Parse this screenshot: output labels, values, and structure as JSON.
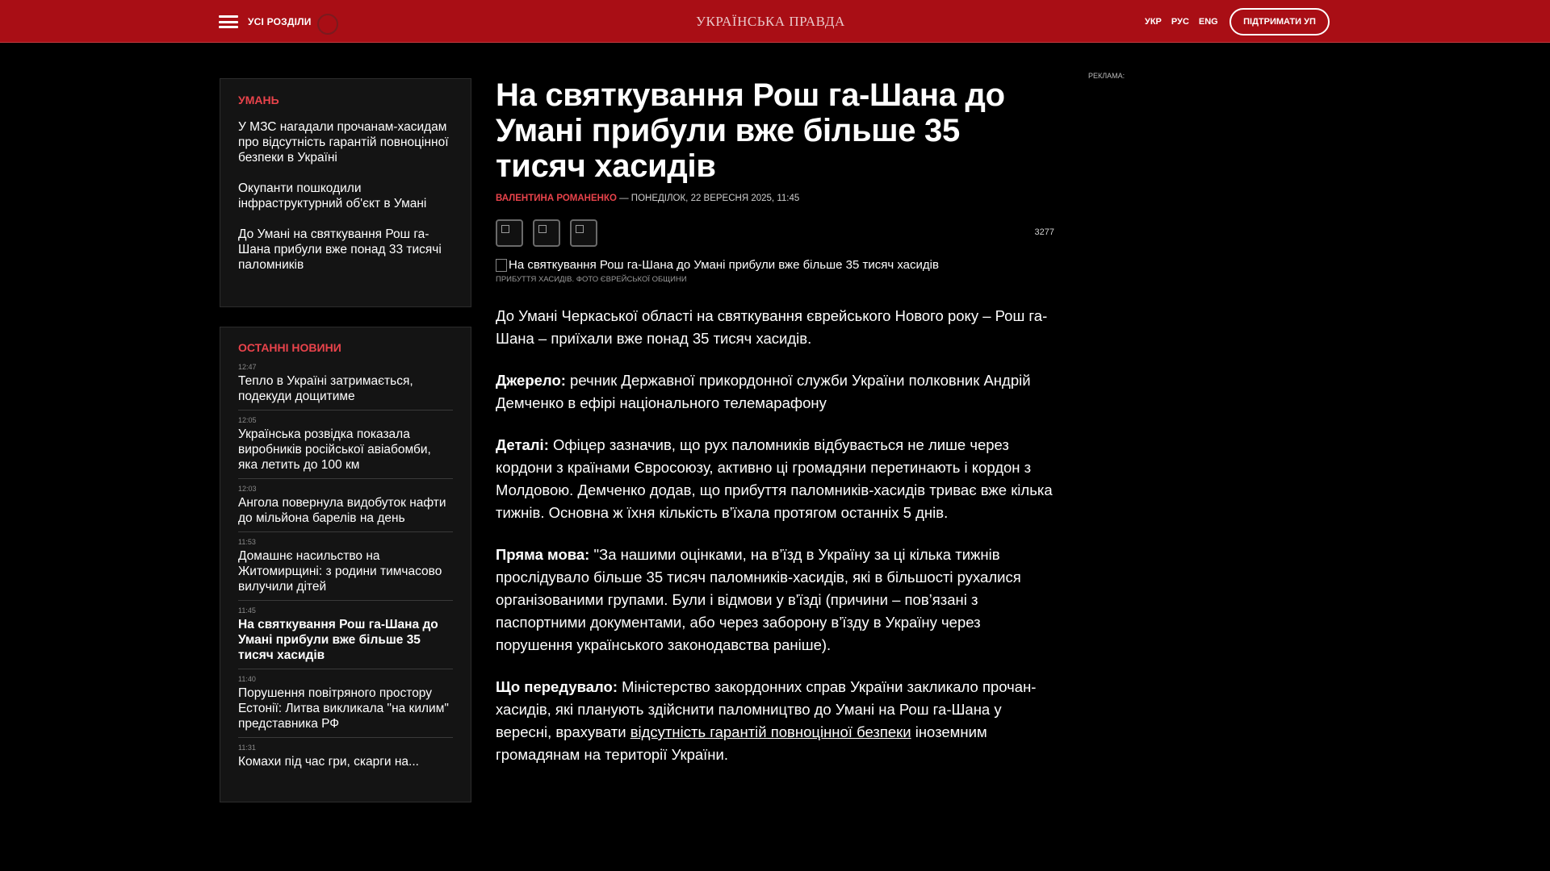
{
  "header": {
    "all_sections": "УСІ РОЗДІЛИ",
    "logo": "УКРАЇНСЬКА ПРАВДА",
    "langs": [
      "УКР",
      "РУС",
      "ENG"
    ],
    "support": "ПІДТРИМАТИ УП"
  },
  "topic_card": {
    "tag": "УМАНЬ",
    "items": [
      "У МЗС нагадали прочанам-хасидам про відсутність гарантій повноцінної безпеки в Україні",
      "Окупанти пошкодили інфраструктурний об'єкт в Умані",
      "До Умані на святкування Рош га-Шана прибули вже понад 33 тисячі паломників"
    ]
  },
  "latest": {
    "tag": "ОСТАННІ НОВИНИ",
    "items": [
      {
        "time": "12:47",
        "title": "Тепло в Україні затримається, подекуди дощитиме"
      },
      {
        "time": "12:05",
        "title": "Українська розвідка показала виробників російської авіабомби, яка летить до 100 км"
      },
      {
        "time": "12:03",
        "title": "Ангола повернула видобуток нафти до мільйона барелів на день"
      },
      {
        "time": "11:53",
        "title": "Домашнє насильство на Житомирщині: з родини тимчасово вилучили дітей"
      },
      {
        "time": "11:45",
        "title": "На святкування Рош га-Шана до Умані прибули вже більше 35 тисяч хасидів"
      },
      {
        "time": "11:40",
        "title": "Порушення повітряного простору Естонії: Литва викликала \"на килим\" представника РФ"
      },
      {
        "time": "11:31",
        "title": "Комахи під час гри, скарги на..."
      }
    ]
  },
  "article": {
    "title": "На святкування Рош га-Шана до Умані прибули вже більше 35 тисяч хасидів",
    "author": "ВАЛЕНТИНА РОМАНЕНКО",
    "date": " — ПОНЕДІЛОК, 22 ВЕРЕСНЯ 2025, 11:45",
    "views": "3277",
    "photo_alt": "На святкування Рош га-Шана до Умані прибули вже більше 35 тисяч хасидів",
    "caption": "ПРИБУТТЯ ХАСИДІВ. ФОТО ЄВРЕЙСЬКОЇ ОБЩИНИ",
    "lead": "До Умані Черкаської області на святкування єврейського Нового року – Рош га-Шана – приїхали вже понад 35 тисяч хасидів.",
    "source_label": "Джерело:",
    "source_text": " речник Державної прикордонної служби України полковник Андрій Демченко в ефірі національного телемарафону",
    "details_label": "Деталі:",
    "details_text": " Офіцер зазначив, що рух паломників відбувається не лише через кордони з країнами Євросоюзу, активно ці громадяни перетинають і кордон з Молдовою. Демченко додав, що прибуття паломників-хасидів триває вже кілька тижнів. Основна ж їхня кількість в’їхала протягом останніх 5 днів.",
    "quote_label": "Пряма мова:",
    "quote_text": " \"За нашими оцінками, на в’їзд в Україну за ці кілька тижнів прослідувало більше 35 тисяч паломників-хасидів, які в більшості рухалися організованими групами. Були і відмови у в'їзді (причини – пов’язані з паспортними документами, або через заборону в’їзду в Україну через порушення українського законодавства раніше).",
    "prev_label": "Що передувало:",
    "prev_text_1": " Міністерство закордонних справ України закликало прочан-хасидів, які планують здійснити паломництво до Умані на Рош га-Шана у вересні, врахувати ",
    "prev_link": "відсутність гарантій повноцінної безпеки",
    "prev_text_2": " іноземним громадянам на території України."
  },
  "ad_label": "РЕКЛАМА:"
}
